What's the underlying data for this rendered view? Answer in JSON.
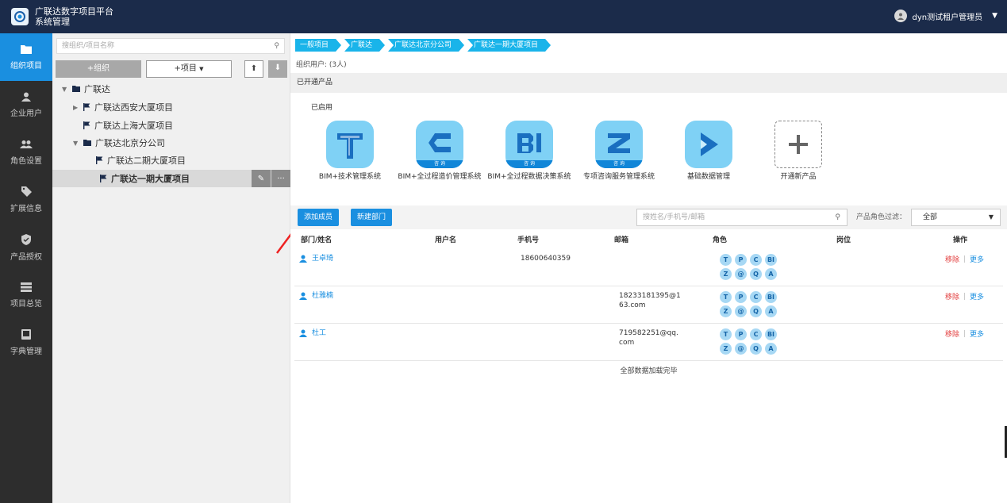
{
  "app": {
    "title_line1": "广联达数字项目平台",
    "title_line2": "系统管理",
    "user_name": "dyn测试租户管理员"
  },
  "nav": [
    {
      "label": "组织项目",
      "icon": "folder-icon",
      "active": true
    },
    {
      "label": "企业用户",
      "icon": "user-icon",
      "active": false
    },
    {
      "label": "角色设置",
      "icon": "group-icon",
      "active": false
    },
    {
      "label": "扩展信息",
      "icon": "tag-icon",
      "active": false
    },
    {
      "label": "产品授权",
      "icon": "shield-icon",
      "active": false
    },
    {
      "label": "项目总览",
      "icon": "list-icon",
      "active": false
    },
    {
      "label": "字典管理",
      "icon": "book-icon",
      "active": false
    }
  ],
  "tree": {
    "search_placeholder": "搜组织/项目名称",
    "add_org": "+组织",
    "add_project": "+项目",
    "items": [
      {
        "label": "广联达"
      },
      {
        "label": "广联达西安大厦项目"
      },
      {
        "label": "广联达上海大厦项目"
      },
      {
        "label": "广联达北京分公司"
      },
      {
        "label": "广联达二期大厦项目"
      },
      {
        "label": "广联达一期大厦项目"
      }
    ]
  },
  "main": {
    "breadcrumbs": [
      "一般项目",
      "广联达",
      "广联达北京分公司",
      "广联达一期大厦项目"
    ],
    "org_users": "组织用户: (3人)",
    "opened_products": "已开通产品",
    "enabled": "已启用",
    "products": [
      {
        "name": "BIM+技术管理系统",
        "glyph": "T",
        "tag": ""
      },
      {
        "name": "BIM+全过程造价管理系统",
        "glyph": "C",
        "tag": "咨 询"
      },
      {
        "name": "BIM+全过程数据决策系统",
        "glyph": "BI",
        "tag": "咨 询"
      },
      {
        "name": "专项咨询服务管理系统",
        "glyph": "Z",
        "tag": "咨 询"
      },
      {
        "name": "基础数据管理",
        "glyph": "P",
        "tag": ""
      },
      {
        "name": "开通新产品",
        "glyph": "+",
        "tag": ""
      }
    ],
    "add_member": "添加成员",
    "new_dept": "新建部门",
    "member_search_placeholder": "搜姓名/手机号/邮箱",
    "role_filter_label": "产品角色过滤：",
    "role_filter_value": "全部",
    "columns": [
      "部门/姓名",
      "用户名",
      "手机号",
      "邮箱",
      "角色",
      "岗位",
      "操作"
    ],
    "rows": [
      {
        "name": "王卓琦",
        "username": "",
        "phone": "18600640359",
        "email_line1": "",
        "email_line2": "",
        "roles": [
          "T",
          "P",
          "C",
          "BI",
          "Z",
          "@",
          "Q",
          "A"
        ]
      },
      {
        "name": "杜雅楠",
        "username": "",
        "phone": "",
        "email_line1": "18233181395@1",
        "email_line2": "63.com",
        "roles": [
          "T",
          "P",
          "C",
          "BI",
          "Z",
          "@",
          "Q",
          "A"
        ]
      },
      {
        "name": "杜工",
        "username": "",
        "phone": "",
        "email_line1": "719582251@qq.",
        "email_line2": "com",
        "roles": [
          "T",
          "P",
          "C",
          "BI",
          "Z",
          "@",
          "Q",
          "A"
        ]
      }
    ],
    "remove": "移除",
    "more": "更多",
    "end_text": "全部数据加载完毕"
  },
  "colors": {
    "primary": "#1a8fe0",
    "topbar": "#1b2b4a",
    "sidebar": "#2d2d2d",
    "crumb": "#19b4ea",
    "danger": "#e23b3b"
  }
}
